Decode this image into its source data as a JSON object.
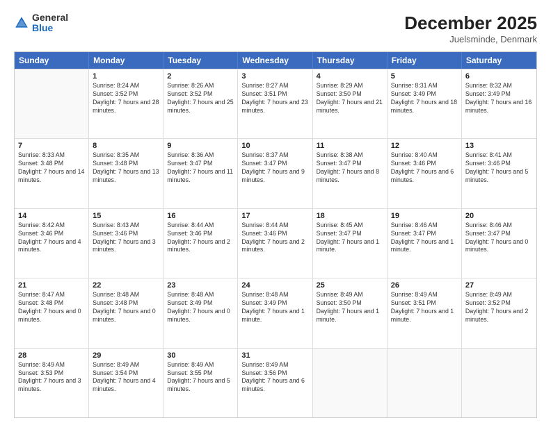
{
  "logo": {
    "general": "General",
    "blue": "Blue"
  },
  "header": {
    "month_year": "December 2025",
    "location": "Juelsminde, Denmark"
  },
  "days_of_week": [
    "Sunday",
    "Monday",
    "Tuesday",
    "Wednesday",
    "Thursday",
    "Friday",
    "Saturday"
  ],
  "weeks": [
    [
      {
        "day": "",
        "empty": true
      },
      {
        "day": "1",
        "sunrise": "8:24 AM",
        "sunset": "3:52 PM",
        "daylight": "7 hours and 28 minutes."
      },
      {
        "day": "2",
        "sunrise": "8:26 AM",
        "sunset": "3:52 PM",
        "daylight": "7 hours and 25 minutes."
      },
      {
        "day": "3",
        "sunrise": "8:27 AM",
        "sunset": "3:51 PM",
        "daylight": "7 hours and 23 minutes."
      },
      {
        "day": "4",
        "sunrise": "8:29 AM",
        "sunset": "3:50 PM",
        "daylight": "7 hours and 21 minutes."
      },
      {
        "day": "5",
        "sunrise": "8:31 AM",
        "sunset": "3:49 PM",
        "daylight": "7 hours and 18 minutes."
      },
      {
        "day": "6",
        "sunrise": "8:32 AM",
        "sunset": "3:49 PM",
        "daylight": "7 hours and 16 minutes."
      }
    ],
    [
      {
        "day": "7",
        "sunrise": "8:33 AM",
        "sunset": "3:48 PM",
        "daylight": "7 hours and 14 minutes."
      },
      {
        "day": "8",
        "sunrise": "8:35 AM",
        "sunset": "3:48 PM",
        "daylight": "7 hours and 13 minutes."
      },
      {
        "day": "9",
        "sunrise": "8:36 AM",
        "sunset": "3:47 PM",
        "daylight": "7 hours and 11 minutes."
      },
      {
        "day": "10",
        "sunrise": "8:37 AM",
        "sunset": "3:47 PM",
        "daylight": "7 hours and 9 minutes."
      },
      {
        "day": "11",
        "sunrise": "8:38 AM",
        "sunset": "3:47 PM",
        "daylight": "7 hours and 8 minutes."
      },
      {
        "day": "12",
        "sunrise": "8:40 AM",
        "sunset": "3:46 PM",
        "daylight": "7 hours and 6 minutes."
      },
      {
        "day": "13",
        "sunrise": "8:41 AM",
        "sunset": "3:46 PM",
        "daylight": "7 hours and 5 minutes."
      }
    ],
    [
      {
        "day": "14",
        "sunrise": "8:42 AM",
        "sunset": "3:46 PM",
        "daylight": "7 hours and 4 minutes."
      },
      {
        "day": "15",
        "sunrise": "8:43 AM",
        "sunset": "3:46 PM",
        "daylight": "7 hours and 3 minutes."
      },
      {
        "day": "16",
        "sunrise": "8:44 AM",
        "sunset": "3:46 PM",
        "daylight": "7 hours and 2 minutes."
      },
      {
        "day": "17",
        "sunrise": "8:44 AM",
        "sunset": "3:46 PM",
        "daylight": "7 hours and 2 minutes."
      },
      {
        "day": "18",
        "sunrise": "8:45 AM",
        "sunset": "3:47 PM",
        "daylight": "7 hours and 1 minute."
      },
      {
        "day": "19",
        "sunrise": "8:46 AM",
        "sunset": "3:47 PM",
        "daylight": "7 hours and 1 minute."
      },
      {
        "day": "20",
        "sunrise": "8:46 AM",
        "sunset": "3:47 PM",
        "daylight": "7 hours and 0 minutes."
      }
    ],
    [
      {
        "day": "21",
        "sunrise": "8:47 AM",
        "sunset": "3:48 PM",
        "daylight": "7 hours and 0 minutes."
      },
      {
        "day": "22",
        "sunrise": "8:48 AM",
        "sunset": "3:48 PM",
        "daylight": "7 hours and 0 minutes."
      },
      {
        "day": "23",
        "sunrise": "8:48 AM",
        "sunset": "3:49 PM",
        "daylight": "7 hours and 0 minutes."
      },
      {
        "day": "24",
        "sunrise": "8:48 AM",
        "sunset": "3:49 PM",
        "daylight": "7 hours and 1 minute."
      },
      {
        "day": "25",
        "sunrise": "8:49 AM",
        "sunset": "3:50 PM",
        "daylight": "7 hours and 1 minute."
      },
      {
        "day": "26",
        "sunrise": "8:49 AM",
        "sunset": "3:51 PM",
        "daylight": "7 hours and 1 minute."
      },
      {
        "day": "27",
        "sunrise": "8:49 AM",
        "sunset": "3:52 PM",
        "daylight": "7 hours and 2 minutes."
      }
    ],
    [
      {
        "day": "28",
        "sunrise": "8:49 AM",
        "sunset": "3:53 PM",
        "daylight": "7 hours and 3 minutes."
      },
      {
        "day": "29",
        "sunrise": "8:49 AM",
        "sunset": "3:54 PM",
        "daylight": "7 hours and 4 minutes."
      },
      {
        "day": "30",
        "sunrise": "8:49 AM",
        "sunset": "3:55 PM",
        "daylight": "7 hours and 5 minutes."
      },
      {
        "day": "31",
        "sunrise": "8:49 AM",
        "sunset": "3:56 PM",
        "daylight": "7 hours and 6 minutes."
      },
      {
        "day": "",
        "empty": true
      },
      {
        "day": "",
        "empty": true
      },
      {
        "day": "",
        "empty": true
      }
    ]
  ]
}
